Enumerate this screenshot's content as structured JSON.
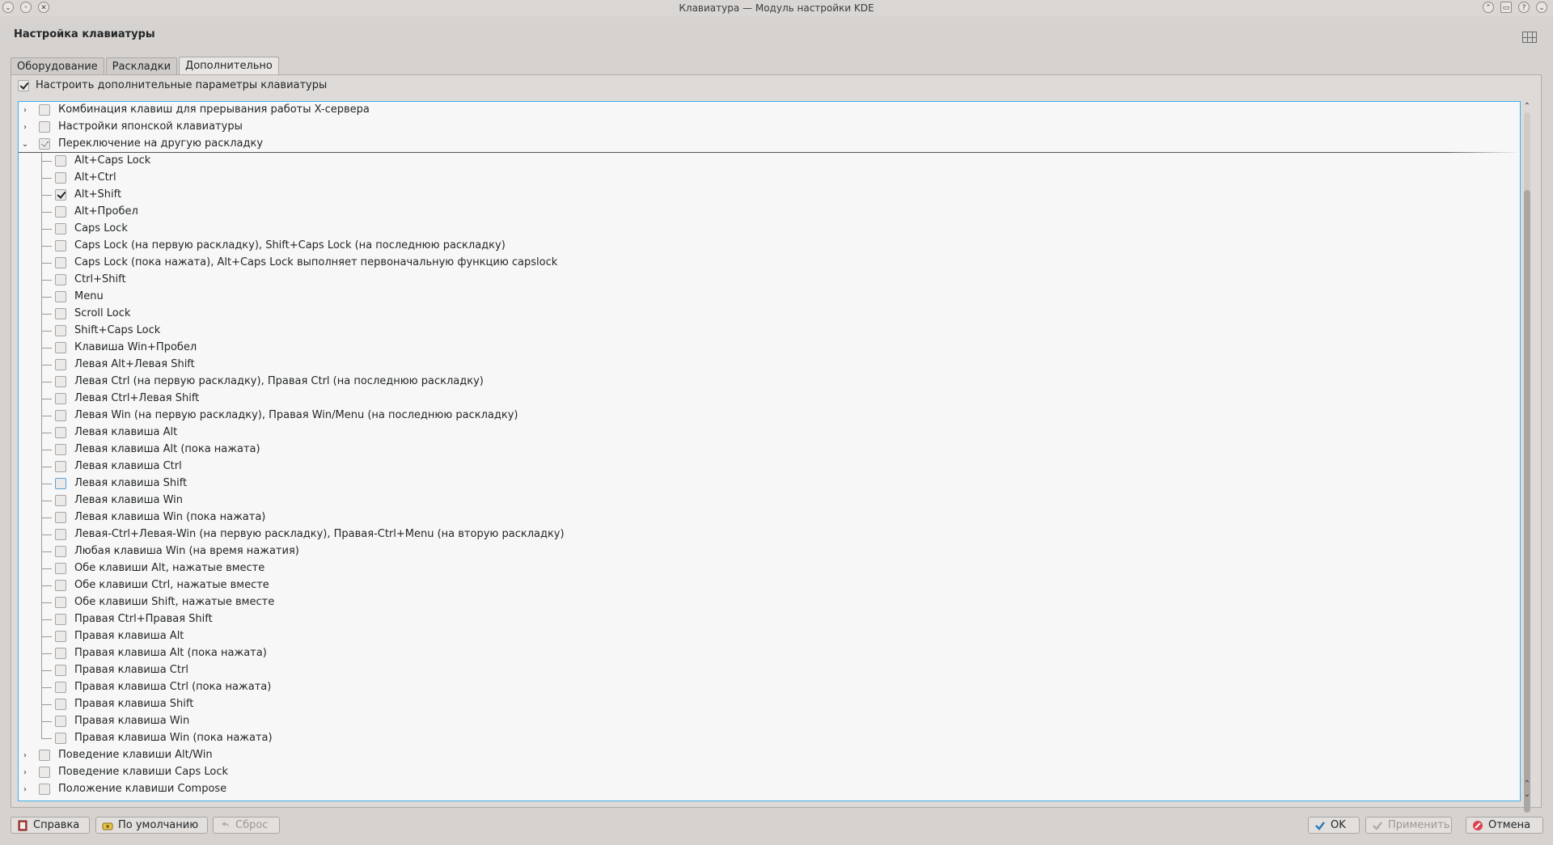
{
  "window": {
    "title": "Клавиатура — Модуль настройки KDE"
  },
  "heading": "Настройка клавиатуры",
  "tabs": [
    "Оборудование",
    "Раскладки",
    "Дополнительно"
  ],
  "active_tab_index": 2,
  "enable_advanced": {
    "label": "Настроить дополнительные параметры клавиатуры",
    "checked": true
  },
  "tree": {
    "groups_top": [
      {
        "label": "Комбинация клавиш для прерывания работы X-сервера",
        "expanded": false,
        "state": "unchecked"
      },
      {
        "label": "Настройки японской клавиатуры",
        "expanded": false,
        "state": "unchecked"
      },
      {
        "label": "Переключение на другую раскладку",
        "expanded": true,
        "state": "partial"
      }
    ],
    "switch_options": [
      {
        "label": "Alt+Caps Lock",
        "checked": false
      },
      {
        "label": "Alt+Ctrl",
        "checked": false
      },
      {
        "label": "Alt+Shift",
        "checked": true
      },
      {
        "label": "Alt+Пробел",
        "checked": false
      },
      {
        "label": "Caps Lock",
        "checked": false
      },
      {
        "label": "Caps Lock (на первую раскладку), Shift+Caps Lock (на последнюю раскладку)",
        "checked": false
      },
      {
        "label": "Caps Lock (пока нажата), Alt+Caps Lock выполняет первоначальную функцию capslock",
        "checked": false
      },
      {
        "label": "Ctrl+Shift",
        "checked": false
      },
      {
        "label": "Menu",
        "checked": false
      },
      {
        "label": "Scroll Lock",
        "checked": false
      },
      {
        "label": "Shift+Caps Lock",
        "checked": false
      },
      {
        "label": "Клавиша Win+Пробел",
        "checked": false
      },
      {
        "label": "Левая Alt+Левая Shift",
        "checked": false
      },
      {
        "label": "Левая Ctrl (на первую раскладку), Правая Ctrl (на последнюю раскладку)",
        "checked": false
      },
      {
        "label": "Левая Ctrl+Левая Shift",
        "checked": false
      },
      {
        "label": "Левая Win (на первую раскладку), Правая Win/Menu (на последнюю раскладку)",
        "checked": false
      },
      {
        "label": "Левая клавиша Alt",
        "checked": false
      },
      {
        "label": "Левая клавиша Alt (пока нажата)",
        "checked": false
      },
      {
        "label": "Левая клавиша Ctrl",
        "checked": false
      },
      {
        "label": "Левая клавиша Shift",
        "checked": false,
        "hover": true
      },
      {
        "label": "Левая клавиша Win",
        "checked": false
      },
      {
        "label": "Левая клавиша Win (пока нажата)",
        "checked": false
      },
      {
        "label": "Левая-Ctrl+Левая-Win (на первую раскладку), Правая-Ctrl+Menu (на вторую раскладку)",
        "checked": false
      },
      {
        "label": "Любая клавиша Win (на время нажатия)",
        "checked": false
      },
      {
        "label": "Обе клавиши Alt, нажатые вместе",
        "checked": false
      },
      {
        "label": "Обе клавиши Ctrl, нажатые вместе",
        "checked": false
      },
      {
        "label": "Обе клавиши Shift, нажатые вместе",
        "checked": false
      },
      {
        "label": "Правая Ctrl+Правая Shift",
        "checked": false
      },
      {
        "label": "Правая клавиша Alt",
        "checked": false
      },
      {
        "label": "Правая клавиша Alt (пока нажата)",
        "checked": false
      },
      {
        "label": "Правая клавиша Ctrl",
        "checked": false
      },
      {
        "label": "Правая клавиша Ctrl (пока нажата)",
        "checked": false
      },
      {
        "label": "Правая клавиша Shift",
        "checked": false
      },
      {
        "label": "Правая клавиша Win",
        "checked": false
      },
      {
        "label": "Правая клавиша Win (пока нажата)",
        "checked": false
      }
    ],
    "groups_bottom": [
      {
        "label": "Поведение клавиши Alt/Win",
        "expanded": false,
        "state": "unchecked"
      },
      {
        "label": "Поведение клавиши Caps Lock",
        "expanded": false,
        "state": "unchecked"
      },
      {
        "label": "Положение клавиши Compose",
        "expanded": false,
        "state": "unchecked"
      }
    ]
  },
  "buttons": {
    "help": "Справка",
    "defaults": "По умолчанию",
    "reset": "Сброс",
    "ok": "OK",
    "apply": "Применить",
    "cancel": "Отмена"
  },
  "icons": {
    "help": "help-book-icon",
    "defaults": "defaults-icon",
    "reset": "undo-icon",
    "ok": "check-icon",
    "apply": "check-icon",
    "cancel": "cancel-icon"
  },
  "colors": {
    "accent": "#3daee9",
    "ok_check": "#2b7bb9",
    "cancel_red": "#da4453"
  }
}
